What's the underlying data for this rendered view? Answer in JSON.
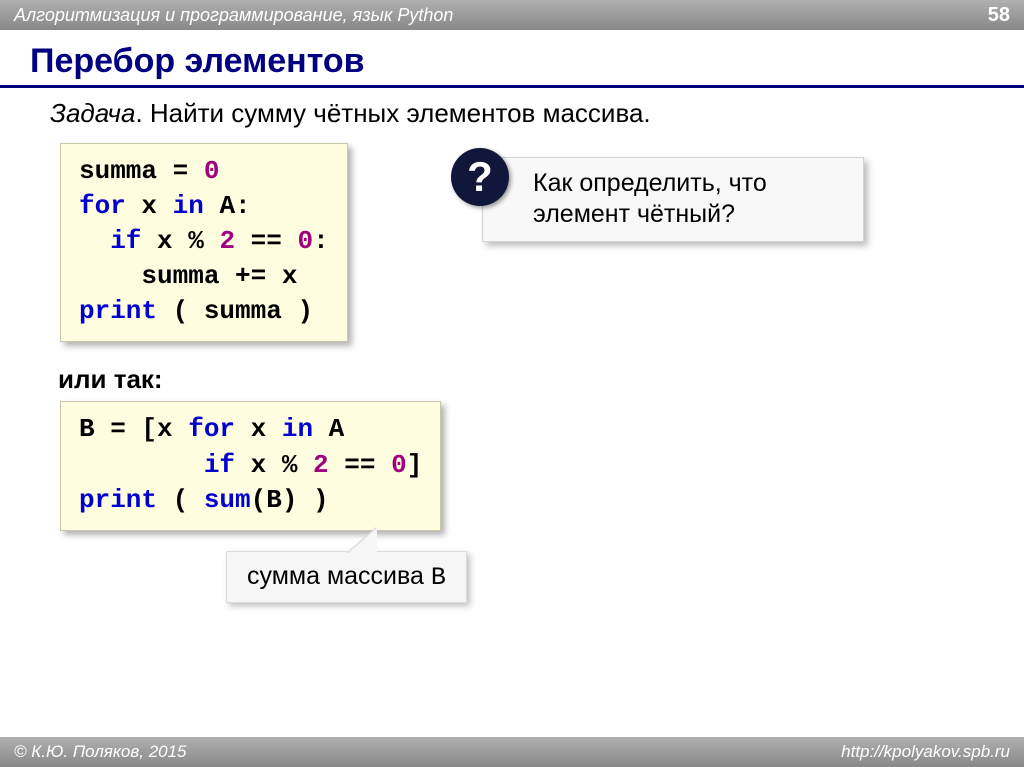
{
  "header": {
    "course": "Алгоритмизация и программирование, язык Python",
    "page": "58"
  },
  "title": "Перебор элементов",
  "task": {
    "label": "Задача",
    "text": ". Найти сумму чётных элементов массива."
  },
  "code1": {
    "l1a": "summa",
    "l1b": " = ",
    "l1c": "0",
    "l2a": "for",
    "l2b": " x ",
    "l2c": "in",
    "l2d": " A:",
    "l3a": "  if",
    "l3b": " x % ",
    "l3c": "2",
    "l3d": " == ",
    "l3e": "0",
    "l3f": ":",
    "l4": "    summa += x",
    "l5a": "print",
    "l5b": " ( summa )"
  },
  "question": {
    "badge": "?",
    "text": "Как определить, что элемент чётный?"
  },
  "alt_label": "или так:",
  "code2": {
    "l1a": "B = [x ",
    "l1b": "for",
    "l1c": " x ",
    "l1d": "in",
    "l1e": " A",
    "l2a": "        if",
    "l2b": " x % ",
    "l2c": "2",
    "l2d": " == ",
    "l2e": "0",
    "l2f": "]",
    "l3a": "print",
    "l3b": " ( ",
    "l3c": "sum",
    "l3d": "(B) )"
  },
  "bubble": {
    "text": "сумма массива ",
    "mono": "B"
  },
  "footer": {
    "left": "© К.Ю. Поляков, 2015",
    "right": "http://kpolyakov.spb.ru"
  }
}
